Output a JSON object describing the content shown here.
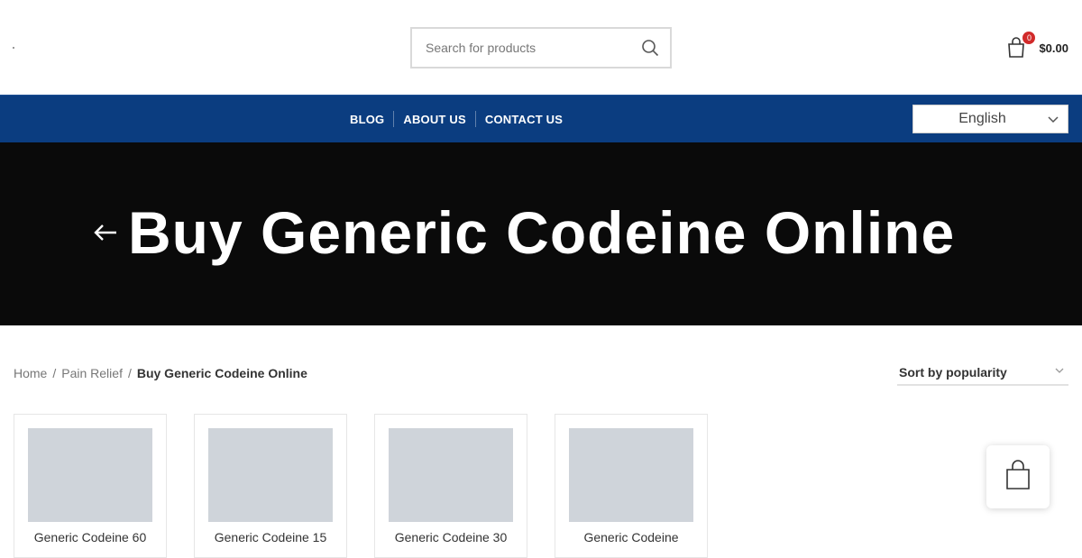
{
  "search": {
    "placeholder": "Search for products"
  },
  "cart": {
    "count": "0",
    "total": "$0.00"
  },
  "nav": {
    "items": [
      {
        "label": "BLOG"
      },
      {
        "label": "ABOUT US"
      },
      {
        "label": "CONTACT US"
      }
    ]
  },
  "language": {
    "selected": "English"
  },
  "hero": {
    "title": "Buy Generic Codeine Online"
  },
  "breadcrumb": {
    "items": [
      "Home",
      "Pain Relief"
    ],
    "current": "Buy Generic Codeine Online",
    "separator": "/"
  },
  "sort": {
    "selected": "Sort by popularity"
  },
  "products": [
    {
      "name": "Generic Codeine 60"
    },
    {
      "name": "Generic Codeine 15"
    },
    {
      "name": "Generic Codeine 30"
    },
    {
      "name": "Generic Codeine"
    }
  ],
  "colors": {
    "nav_bg": "#0b3d80",
    "hero_bg": "#0a0a0a",
    "badge": "#d12a2a",
    "placeholder_img": "#cfd4da"
  }
}
